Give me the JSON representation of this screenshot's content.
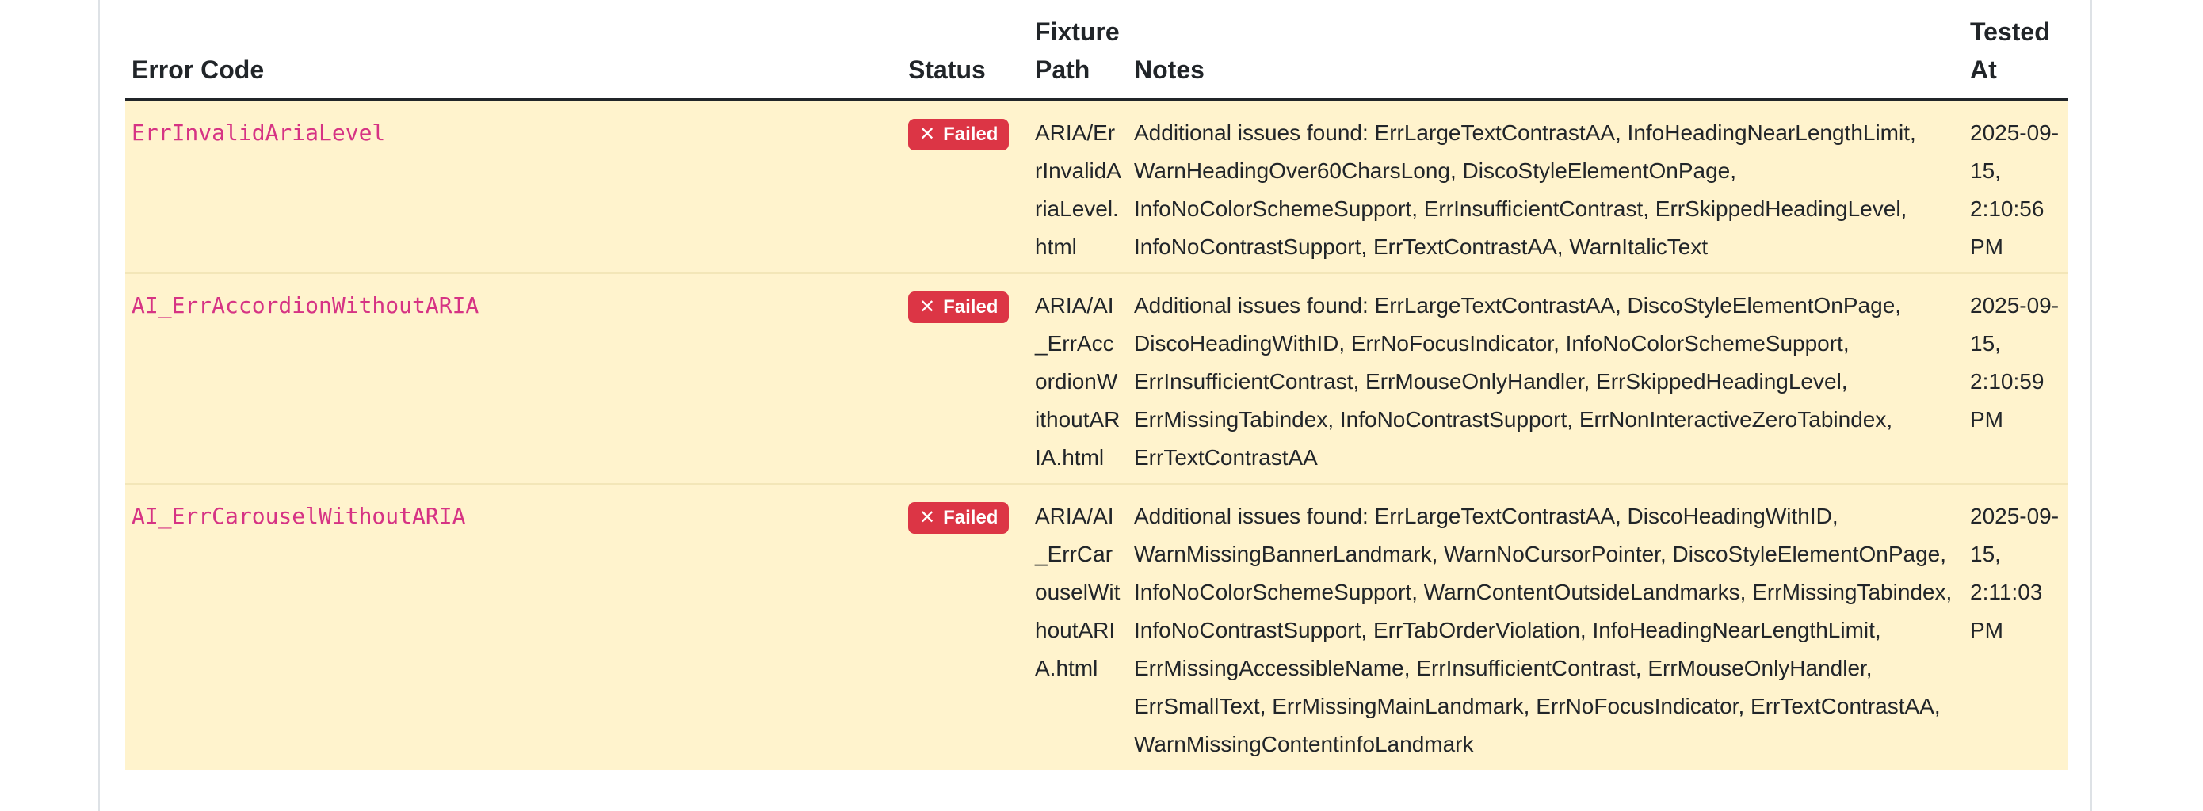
{
  "table": {
    "headers": {
      "error_code": "Error Code",
      "status": "Status",
      "fixture_path": "Fixture Path",
      "notes": "Notes",
      "tested_at": "Tested At"
    },
    "rows": [
      {
        "error_code": "ErrInvalidAriaLevel",
        "status": "Failed",
        "fixture_path": "ARIA/ErrInvalidAriaLevel.html",
        "notes": "Additional issues found: ErrLargeTextContrastAA, InfoHeadingNearLengthLimit, WarnHeadingOver60CharsLong, DiscoStyleElementOnPage, InfoNoColorSchemeSupport, ErrInsufficientContrast, ErrSkippedHeadingLevel, InfoNoContrastSupport, ErrTextContrastAA, WarnItalicText",
        "tested_at": "2025-09-15, 2:10:56 PM"
      },
      {
        "error_code": "AI_ErrAccordionWithoutARIA",
        "status": "Failed",
        "fixture_path": "ARIA/AI_ErrAccordionWithoutARIA.html",
        "notes": "Additional issues found: ErrLargeTextContrastAA, DiscoStyleElementOnPage, DiscoHeadingWithID, ErrNoFocusIndicator, InfoNoColorSchemeSupport, ErrInsufficientContrast, ErrMouseOnlyHandler, ErrSkippedHeadingLevel, ErrMissingTabindex, InfoNoContrastSupport, ErrNonInteractiveZeroTabindex, ErrTextContrastAA",
        "tested_at": "2025-09-15, 2:10:59 PM"
      },
      {
        "error_code": "AI_ErrCarouselWithoutARIA",
        "status": "Failed",
        "fixture_path": "ARIA/AI_ErrCarouselWithoutARIA.html",
        "notes": "Additional issues found: ErrLargeTextContrastAA, DiscoHeadingWithID, WarnMissingBannerLandmark, WarnNoCursorPointer, DiscoStyleElementOnPage, InfoNoColorSchemeSupport, WarnContentOutsideLandmarks, ErrMissingTabindex, InfoNoContrastSupport, ErrTabOrderViolation, InfoHeadingNearLengthLimit, ErrMissingAccessibleName, ErrInsufficientContrast, ErrMouseOnlyHandler, ErrSmallText, ErrMissingMainLandmark, ErrNoFocusIndicator, ErrTextContrastAA, WarnMissingContentinfoLandmark",
        "tested_at": "2025-09-15, 2:11:03 PM"
      }
    ]
  },
  "colors": {
    "row_failed_bg": "#fff3cd",
    "badge_failed": "#dc3545",
    "code_text": "#d63384"
  },
  "icons": {
    "badge_icon": "x-icon"
  }
}
